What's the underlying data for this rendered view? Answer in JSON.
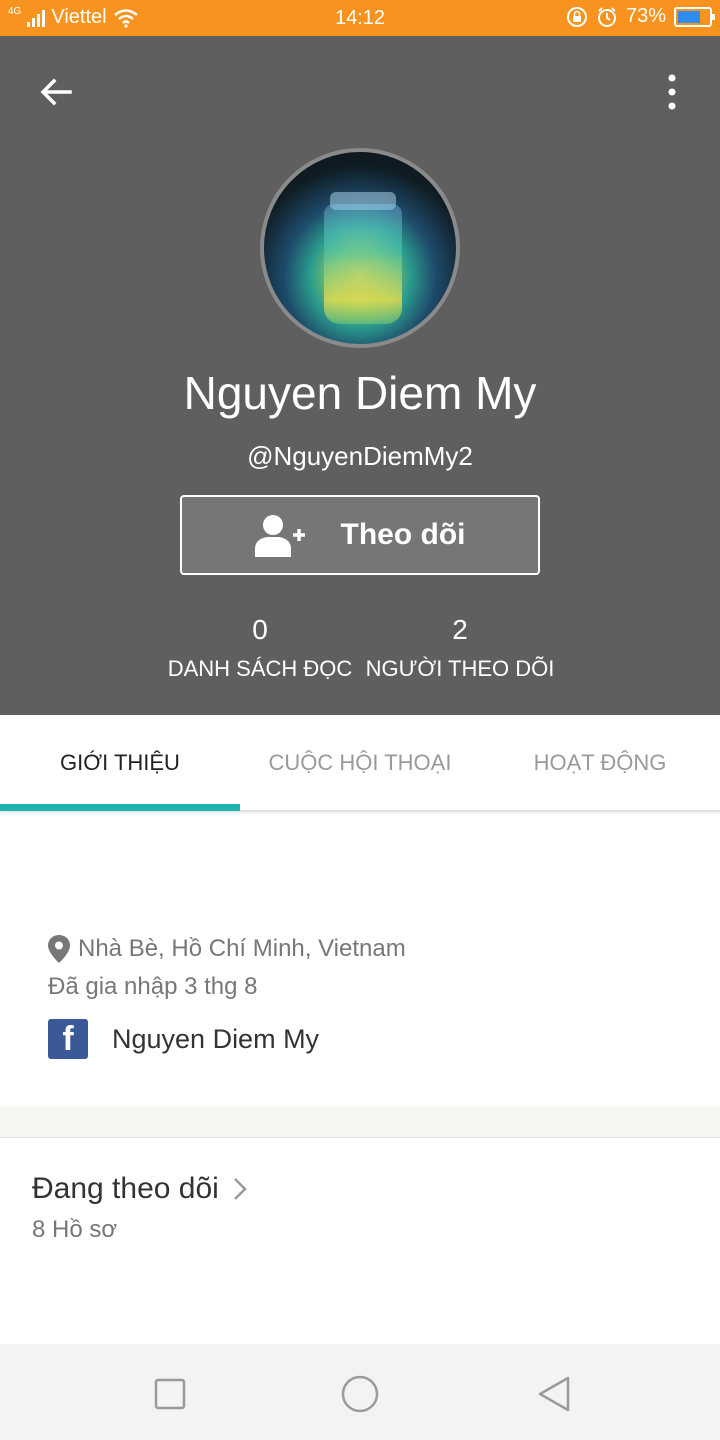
{
  "status_bar": {
    "network_type": "4G",
    "carrier": "Viettel",
    "time": "14:12",
    "battery": "73%",
    "battery_level": 0.73,
    "colors": {
      "background": "#f7931e",
      "battery_fill": "#2f8cf2"
    },
    "icons": [
      "signal-icon",
      "wifi-icon",
      "rotation-lock-icon",
      "alarm-icon",
      "battery-icon"
    ]
  },
  "header": {
    "background": "#5f5f5f",
    "back_icon": "arrow-left-icon",
    "menu_icon": "more-vertical-icon"
  },
  "profile": {
    "name": "Nguyen Diem My",
    "handle": "@NguyenDiemMy2",
    "follow_button": {
      "label": "Theo dõi",
      "icon": "add-user-icon"
    },
    "stats": [
      {
        "value": "0",
        "label": "DANH SÁCH ĐỌC"
      },
      {
        "value": "2",
        "label": "NGƯỜI THEO DÕI"
      }
    ]
  },
  "tabs": [
    {
      "label": "GIỚI THIỆU",
      "active": true
    },
    {
      "label": "CUỘC HỘI THOẠI",
      "active": false
    },
    {
      "label": "HOẠT ĐỘNG",
      "active": false
    }
  ],
  "accent_color": "#1fb1ad",
  "about": {
    "location": "Nhà Bè, Hồ Chí Minh, Vietnam",
    "joined": "Đã gia nhập 3 thg 8",
    "facebook_name": "Nguyen Diem My",
    "facebook_icon_letter": "f"
  },
  "following": {
    "title": "Đang theo dõi",
    "count": "8 Hồ sơ"
  },
  "navbar": {
    "icons": [
      "recent-apps-icon",
      "home-icon",
      "back-icon"
    ]
  }
}
